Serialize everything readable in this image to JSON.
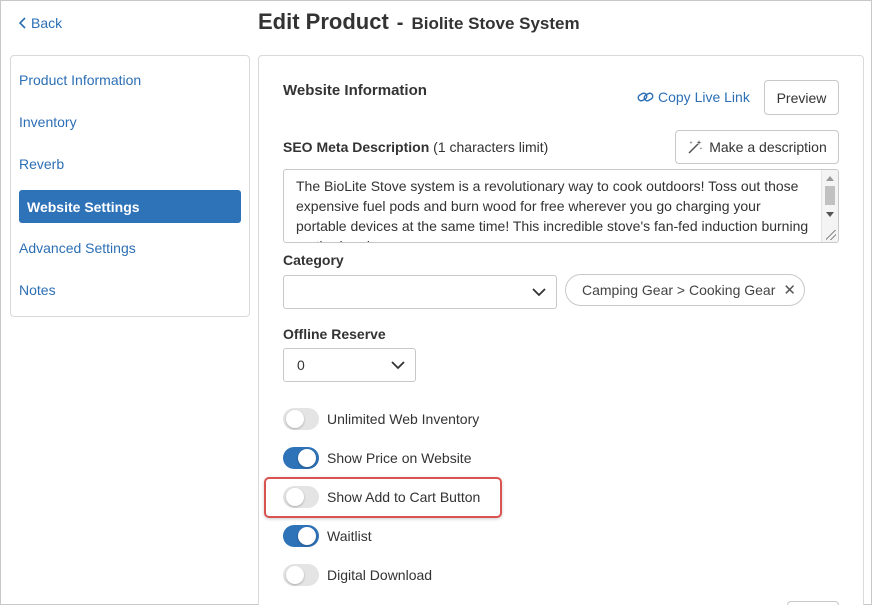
{
  "nav": {
    "back_label": "Back"
  },
  "header": {
    "title": "Edit Product",
    "separator": "-",
    "product_name": "Biolite Stove System"
  },
  "sidebar": {
    "items": [
      {
        "label": "Product Information",
        "active": false
      },
      {
        "label": "Inventory",
        "active": false
      },
      {
        "label": "Reverb",
        "active": false
      },
      {
        "label": "Website Settings",
        "active": true
      },
      {
        "label": "Advanced Settings",
        "active": false
      },
      {
        "label": "Notes",
        "active": false
      }
    ]
  },
  "panel": {
    "section_title": "Website Information",
    "copy_link_label": "Copy Live Link",
    "preview_label": "Preview",
    "seo": {
      "label": "SEO Meta Description",
      "hint": "(1 characters limit)",
      "make_description_label": "Make a description",
      "value": "The BioLite Stove system is a revolutionary way to cook outdoors! Toss out those expensive fuel pods and burn wood for free wherever you go charging your portable devices at the same time! This incredible stove's fan-fed induction burning method and"
    },
    "category": {
      "label": "Category",
      "selected_value": "",
      "tag": "Camping Gear > Cooking Gear",
      "tag_remove": "✕"
    },
    "offline_reserve": {
      "label": "Offline Reserve",
      "value": "0"
    },
    "toggles": [
      {
        "label": "Unlimited Web Inventory",
        "on": false
      },
      {
        "label": "Show Price on Website",
        "on": true
      },
      {
        "label": "Show Add to Cart Button",
        "on": false
      },
      {
        "label": "Waitlist",
        "on": true
      },
      {
        "label": "Digital Download",
        "on": false
      }
    ]
  },
  "colors": {
    "accent": "#2e72b8",
    "link": "#2c6fb5",
    "highlight": "#d9534f",
    "toggle_off": "#e4e4e4"
  }
}
